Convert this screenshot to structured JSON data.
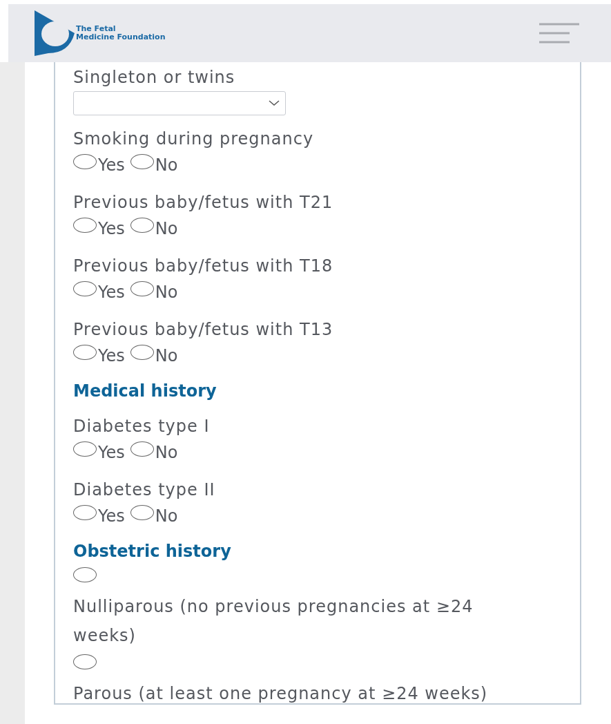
{
  "header": {
    "logo_text_line1": "The Fetal",
    "logo_text_line2": "Medicine Foundation"
  },
  "form": [
    {
      "kind": "select",
      "label": "Singleton or twins"
    },
    {
      "kind": "yesno",
      "label": "Smoking during pregnancy",
      "options": [
        {
          "label": "Yes",
          "selected": false
        },
        {
          "label": "No",
          "selected": false
        }
      ]
    },
    {
      "kind": "yesno",
      "label": "Previous baby/fetus with T21",
      "options": [
        {
          "label": "Yes",
          "selected": false
        },
        {
          "label": "No",
          "selected": false
        }
      ]
    },
    {
      "kind": "yesno",
      "label": "Previous baby/fetus with T18",
      "options": [
        {
          "label": "Yes",
          "selected": false
        },
        {
          "label": "No",
          "selected": false
        }
      ]
    },
    {
      "kind": "yesno",
      "label": "Previous baby/fetus with T13",
      "options": [
        {
          "label": "Yes",
          "selected": false
        },
        {
          "label": "No",
          "selected": false
        }
      ]
    },
    {
      "kind": "heading",
      "label": "Medical history"
    },
    {
      "kind": "yesno",
      "label": "Diabetes type I",
      "options": [
        {
          "label": "Yes",
          "selected": false
        },
        {
          "label": "No",
          "selected": false
        }
      ]
    },
    {
      "kind": "yesno",
      "label": "Diabetes type II",
      "options": [
        {
          "label": "Yes",
          "selected": false
        },
        {
          "label": "No",
          "selected": false
        }
      ]
    },
    {
      "kind": "heading",
      "label": "Obstetric history"
    },
    {
      "kind": "radio",
      "label": "Nulliparous (no previous pregnancies at ≥24 weeks)",
      "selected": false
    },
    {
      "kind": "radio",
      "label": "Parous (at least one pregnancy at ≥24 weeks)",
      "selected": false
    }
  ]
}
